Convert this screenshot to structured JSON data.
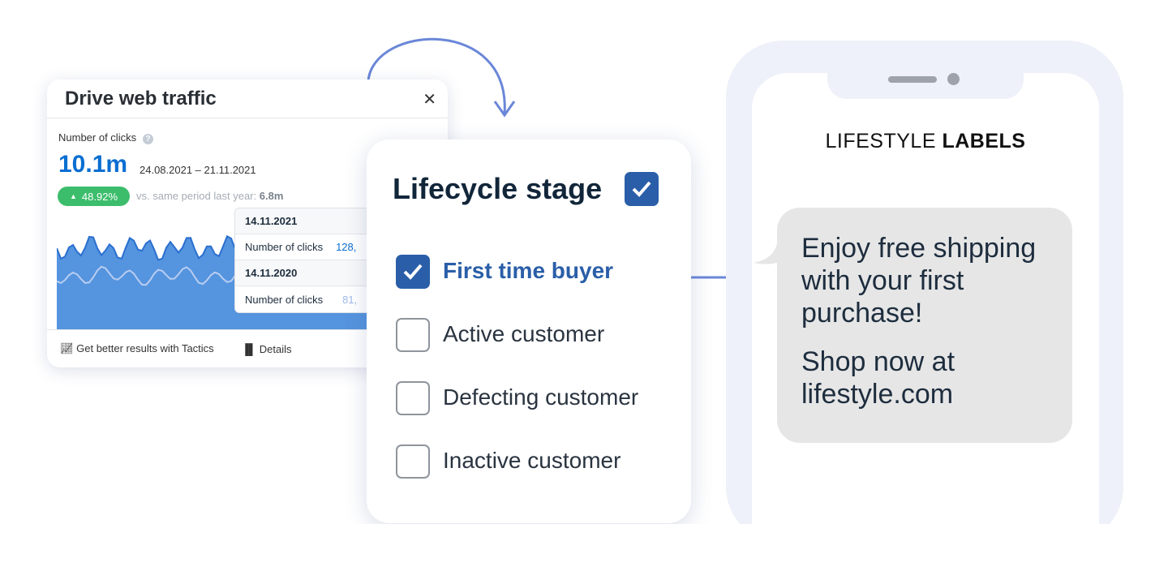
{
  "traffic_card": {
    "title": "Drive web traffic",
    "metric_label": "Number of clicks",
    "value": "10.1m",
    "date_range": "24.08.2021 – 21.11.2021",
    "change": "48.92%",
    "comparison_label": "vs. same period last year:",
    "comparison_value": "6.8m",
    "tooltip": [
      {
        "date": "14.11.2021",
        "label": "Number of clicks",
        "value": "128,"
      },
      {
        "date": "14.11.2020",
        "label": "Number of clicks",
        "value": "81,"
      }
    ],
    "footer": {
      "tactics": "Get better results with Tactics",
      "details": "Details"
    },
    "colors": {
      "current": "#2a6fd0",
      "fill": "#5594de",
      "previous": "#b8cdf2",
      "badge": "#3cbd6c"
    }
  },
  "lifecycle": {
    "title": "Lifecycle stage",
    "title_checked": true,
    "options": [
      {
        "label": "First time buyer",
        "checked": true
      },
      {
        "label": "Active customer",
        "checked": false
      },
      {
        "label": "Defecting customer",
        "checked": false
      },
      {
        "label": "Inactive customer",
        "checked": false
      }
    ]
  },
  "phone": {
    "brand_light": "LIFESTYLE",
    "brand_bold": "LABELS",
    "message_1": "Enjoy free shipping with your first purchase!",
    "message_2": "Shop now at lifestyle.com"
  },
  "accent": "#6a87d8"
}
